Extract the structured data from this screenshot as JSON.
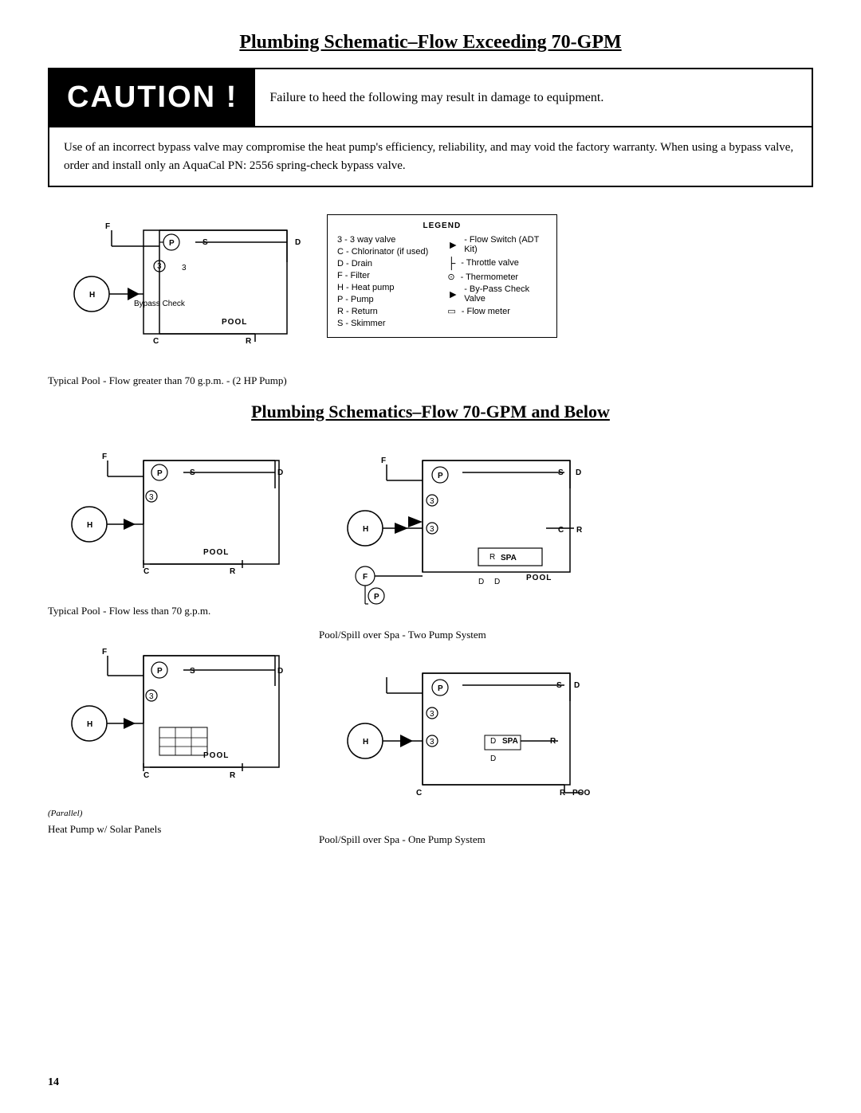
{
  "page": {
    "title": "Plumbing Schematic–Flow Exceeding 70-GPM",
    "title2": "Plumbing Schematics–Flow 70-GPM and Below",
    "page_number": "14"
  },
  "caution": {
    "label": "CAUTION !",
    "text": "Failure to heed the following may result in damage to equipment.",
    "body": "Use of an incorrect bypass valve may compromise the heat pump's efficiency, reliability, and may void the factory warranty.  When using a bypass valve, order and install only an AquaCal PN: 2556 spring-check bypass valve."
  },
  "legend": {
    "title": "LEGEND",
    "items_left": [
      "3 - 3 way valve",
      "C - Chlorinator (if used)",
      "D - Drain",
      "F - Filter",
      "H - Heat pump",
      "P - Pump",
      "R - Return",
      "S - Skimmer"
    ],
    "items_right": [
      "- Flow Switch (ADT Kit)",
      "- Throttle valve",
      "- Thermometer",
      "- By-Pass Check Valve",
      "- Flow meter"
    ]
  },
  "captions": {
    "top_pool": "Typical Pool - Flow greater than 70 g.p.m. - (2 HP Pump)",
    "bottom_pool1": "Typical Pool - Flow less than 70 g.p.m.",
    "bottom_pool2": "Pool/Spill over Spa - Two Pump System",
    "bottom_solar": "Heat Pump w/ Solar Panels",
    "bottom_spa": "Pool/Spill over Spa - One Pump System"
  }
}
